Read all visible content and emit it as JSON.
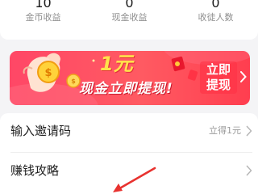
{
  "stats": [
    {
      "value": "10",
      "label": "金币收益"
    },
    {
      "value": "0",
      "label": "现金收益"
    },
    {
      "value": "0",
      "label": "收徒人数"
    }
  ],
  "banner": {
    "amount": "1元",
    "slogan": "现金立即提现!",
    "cta": "立即提现"
  },
  "list": {
    "invite": {
      "title": "输入邀请码",
      "hint": "立得1元"
    },
    "guide": {
      "title": "赚钱攻略"
    }
  },
  "colors": {
    "banner_start": "#ff4766",
    "banner_end": "#ff3e4f",
    "amount_yellow": "#ffe14b",
    "pointer_red": "#e8322f"
  }
}
